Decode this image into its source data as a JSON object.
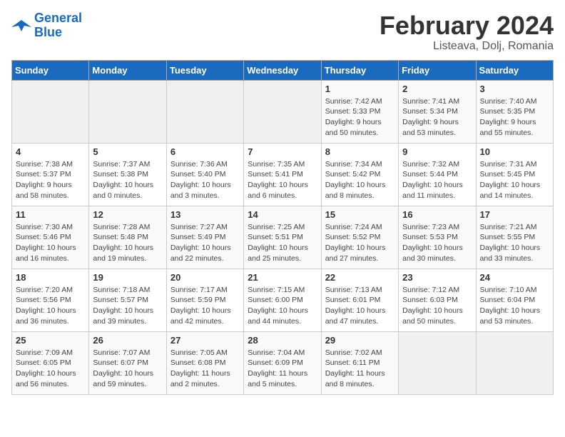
{
  "header": {
    "logo_line1": "General",
    "logo_line2": "Blue",
    "month": "February 2024",
    "location": "Listeava, Dolj, Romania"
  },
  "days_of_week": [
    "Sunday",
    "Monday",
    "Tuesday",
    "Wednesday",
    "Thursday",
    "Friday",
    "Saturday"
  ],
  "weeks": [
    [
      {
        "day": "",
        "detail": ""
      },
      {
        "day": "",
        "detail": ""
      },
      {
        "day": "",
        "detail": ""
      },
      {
        "day": "",
        "detail": ""
      },
      {
        "day": "1",
        "detail": "Sunrise: 7:42 AM\nSunset: 5:33 PM\nDaylight: 9 hours\nand 50 minutes."
      },
      {
        "day": "2",
        "detail": "Sunrise: 7:41 AM\nSunset: 5:34 PM\nDaylight: 9 hours\nand 53 minutes."
      },
      {
        "day": "3",
        "detail": "Sunrise: 7:40 AM\nSunset: 5:35 PM\nDaylight: 9 hours\nand 55 minutes."
      }
    ],
    [
      {
        "day": "4",
        "detail": "Sunrise: 7:38 AM\nSunset: 5:37 PM\nDaylight: 9 hours\nand 58 minutes."
      },
      {
        "day": "5",
        "detail": "Sunrise: 7:37 AM\nSunset: 5:38 PM\nDaylight: 10 hours\nand 0 minutes."
      },
      {
        "day": "6",
        "detail": "Sunrise: 7:36 AM\nSunset: 5:40 PM\nDaylight: 10 hours\nand 3 minutes."
      },
      {
        "day": "7",
        "detail": "Sunrise: 7:35 AM\nSunset: 5:41 PM\nDaylight: 10 hours\nand 6 minutes."
      },
      {
        "day": "8",
        "detail": "Sunrise: 7:34 AM\nSunset: 5:42 PM\nDaylight: 10 hours\nand 8 minutes."
      },
      {
        "day": "9",
        "detail": "Sunrise: 7:32 AM\nSunset: 5:44 PM\nDaylight: 10 hours\nand 11 minutes."
      },
      {
        "day": "10",
        "detail": "Sunrise: 7:31 AM\nSunset: 5:45 PM\nDaylight: 10 hours\nand 14 minutes."
      }
    ],
    [
      {
        "day": "11",
        "detail": "Sunrise: 7:30 AM\nSunset: 5:46 PM\nDaylight: 10 hours\nand 16 minutes."
      },
      {
        "day": "12",
        "detail": "Sunrise: 7:28 AM\nSunset: 5:48 PM\nDaylight: 10 hours\nand 19 minutes."
      },
      {
        "day": "13",
        "detail": "Sunrise: 7:27 AM\nSunset: 5:49 PM\nDaylight: 10 hours\nand 22 minutes."
      },
      {
        "day": "14",
        "detail": "Sunrise: 7:25 AM\nSunset: 5:51 PM\nDaylight: 10 hours\nand 25 minutes."
      },
      {
        "day": "15",
        "detail": "Sunrise: 7:24 AM\nSunset: 5:52 PM\nDaylight: 10 hours\nand 27 minutes."
      },
      {
        "day": "16",
        "detail": "Sunrise: 7:23 AM\nSunset: 5:53 PM\nDaylight: 10 hours\nand 30 minutes."
      },
      {
        "day": "17",
        "detail": "Sunrise: 7:21 AM\nSunset: 5:55 PM\nDaylight: 10 hours\nand 33 minutes."
      }
    ],
    [
      {
        "day": "18",
        "detail": "Sunrise: 7:20 AM\nSunset: 5:56 PM\nDaylight: 10 hours\nand 36 minutes."
      },
      {
        "day": "19",
        "detail": "Sunrise: 7:18 AM\nSunset: 5:57 PM\nDaylight: 10 hours\nand 39 minutes."
      },
      {
        "day": "20",
        "detail": "Sunrise: 7:17 AM\nSunset: 5:59 PM\nDaylight: 10 hours\nand 42 minutes."
      },
      {
        "day": "21",
        "detail": "Sunrise: 7:15 AM\nSunset: 6:00 PM\nDaylight: 10 hours\nand 44 minutes."
      },
      {
        "day": "22",
        "detail": "Sunrise: 7:13 AM\nSunset: 6:01 PM\nDaylight: 10 hours\nand 47 minutes."
      },
      {
        "day": "23",
        "detail": "Sunrise: 7:12 AM\nSunset: 6:03 PM\nDaylight: 10 hours\nand 50 minutes."
      },
      {
        "day": "24",
        "detail": "Sunrise: 7:10 AM\nSunset: 6:04 PM\nDaylight: 10 hours\nand 53 minutes."
      }
    ],
    [
      {
        "day": "25",
        "detail": "Sunrise: 7:09 AM\nSunset: 6:05 PM\nDaylight: 10 hours\nand 56 minutes."
      },
      {
        "day": "26",
        "detail": "Sunrise: 7:07 AM\nSunset: 6:07 PM\nDaylight: 10 hours\nand 59 minutes."
      },
      {
        "day": "27",
        "detail": "Sunrise: 7:05 AM\nSunset: 6:08 PM\nDaylight: 11 hours\nand 2 minutes."
      },
      {
        "day": "28",
        "detail": "Sunrise: 7:04 AM\nSunset: 6:09 PM\nDaylight: 11 hours\nand 5 minutes."
      },
      {
        "day": "29",
        "detail": "Sunrise: 7:02 AM\nSunset: 6:11 PM\nDaylight: 11 hours\nand 8 minutes."
      },
      {
        "day": "",
        "detail": ""
      },
      {
        "day": "",
        "detail": ""
      }
    ]
  ]
}
